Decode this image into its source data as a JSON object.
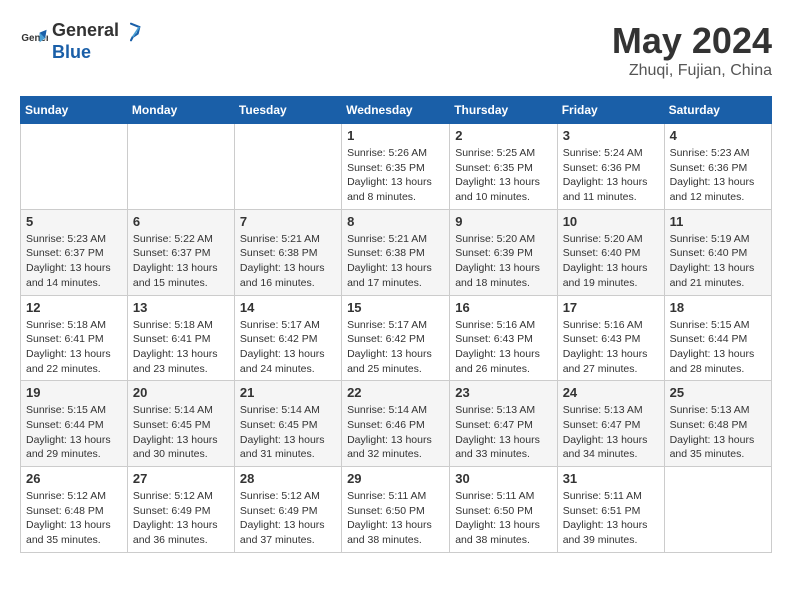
{
  "header": {
    "logo_general": "General",
    "logo_blue": "Blue",
    "month_year": "May 2024",
    "location": "Zhuqi, Fujian, China"
  },
  "weekdays": [
    "Sunday",
    "Monday",
    "Tuesday",
    "Wednesday",
    "Thursday",
    "Friday",
    "Saturday"
  ],
  "weeks": [
    [
      {
        "day": "",
        "info": ""
      },
      {
        "day": "",
        "info": ""
      },
      {
        "day": "",
        "info": ""
      },
      {
        "day": "1",
        "info": "Sunrise: 5:26 AM\nSunset: 6:35 PM\nDaylight: 13 hours\nand 8 minutes."
      },
      {
        "day": "2",
        "info": "Sunrise: 5:25 AM\nSunset: 6:35 PM\nDaylight: 13 hours\nand 10 minutes."
      },
      {
        "day": "3",
        "info": "Sunrise: 5:24 AM\nSunset: 6:36 PM\nDaylight: 13 hours\nand 11 minutes."
      },
      {
        "day": "4",
        "info": "Sunrise: 5:23 AM\nSunset: 6:36 PM\nDaylight: 13 hours\nand 12 minutes."
      }
    ],
    [
      {
        "day": "5",
        "info": "Sunrise: 5:23 AM\nSunset: 6:37 PM\nDaylight: 13 hours\nand 14 minutes."
      },
      {
        "day": "6",
        "info": "Sunrise: 5:22 AM\nSunset: 6:37 PM\nDaylight: 13 hours\nand 15 minutes."
      },
      {
        "day": "7",
        "info": "Sunrise: 5:21 AM\nSunset: 6:38 PM\nDaylight: 13 hours\nand 16 minutes."
      },
      {
        "day": "8",
        "info": "Sunrise: 5:21 AM\nSunset: 6:38 PM\nDaylight: 13 hours\nand 17 minutes."
      },
      {
        "day": "9",
        "info": "Sunrise: 5:20 AM\nSunset: 6:39 PM\nDaylight: 13 hours\nand 18 minutes."
      },
      {
        "day": "10",
        "info": "Sunrise: 5:20 AM\nSunset: 6:40 PM\nDaylight: 13 hours\nand 19 minutes."
      },
      {
        "day": "11",
        "info": "Sunrise: 5:19 AM\nSunset: 6:40 PM\nDaylight: 13 hours\nand 21 minutes."
      }
    ],
    [
      {
        "day": "12",
        "info": "Sunrise: 5:18 AM\nSunset: 6:41 PM\nDaylight: 13 hours\nand 22 minutes."
      },
      {
        "day": "13",
        "info": "Sunrise: 5:18 AM\nSunset: 6:41 PM\nDaylight: 13 hours\nand 23 minutes."
      },
      {
        "day": "14",
        "info": "Sunrise: 5:17 AM\nSunset: 6:42 PM\nDaylight: 13 hours\nand 24 minutes."
      },
      {
        "day": "15",
        "info": "Sunrise: 5:17 AM\nSunset: 6:42 PM\nDaylight: 13 hours\nand 25 minutes."
      },
      {
        "day": "16",
        "info": "Sunrise: 5:16 AM\nSunset: 6:43 PM\nDaylight: 13 hours\nand 26 minutes."
      },
      {
        "day": "17",
        "info": "Sunrise: 5:16 AM\nSunset: 6:43 PM\nDaylight: 13 hours\nand 27 minutes."
      },
      {
        "day": "18",
        "info": "Sunrise: 5:15 AM\nSunset: 6:44 PM\nDaylight: 13 hours\nand 28 minutes."
      }
    ],
    [
      {
        "day": "19",
        "info": "Sunrise: 5:15 AM\nSunset: 6:44 PM\nDaylight: 13 hours\nand 29 minutes."
      },
      {
        "day": "20",
        "info": "Sunrise: 5:14 AM\nSunset: 6:45 PM\nDaylight: 13 hours\nand 30 minutes."
      },
      {
        "day": "21",
        "info": "Sunrise: 5:14 AM\nSunset: 6:45 PM\nDaylight: 13 hours\nand 31 minutes."
      },
      {
        "day": "22",
        "info": "Sunrise: 5:14 AM\nSunset: 6:46 PM\nDaylight: 13 hours\nand 32 minutes."
      },
      {
        "day": "23",
        "info": "Sunrise: 5:13 AM\nSunset: 6:47 PM\nDaylight: 13 hours\nand 33 minutes."
      },
      {
        "day": "24",
        "info": "Sunrise: 5:13 AM\nSunset: 6:47 PM\nDaylight: 13 hours\nand 34 minutes."
      },
      {
        "day": "25",
        "info": "Sunrise: 5:13 AM\nSunset: 6:48 PM\nDaylight: 13 hours\nand 35 minutes."
      }
    ],
    [
      {
        "day": "26",
        "info": "Sunrise: 5:12 AM\nSunset: 6:48 PM\nDaylight: 13 hours\nand 35 minutes."
      },
      {
        "day": "27",
        "info": "Sunrise: 5:12 AM\nSunset: 6:49 PM\nDaylight: 13 hours\nand 36 minutes."
      },
      {
        "day": "28",
        "info": "Sunrise: 5:12 AM\nSunset: 6:49 PM\nDaylight: 13 hours\nand 37 minutes."
      },
      {
        "day": "29",
        "info": "Sunrise: 5:11 AM\nSunset: 6:50 PM\nDaylight: 13 hours\nand 38 minutes."
      },
      {
        "day": "30",
        "info": "Sunrise: 5:11 AM\nSunset: 6:50 PM\nDaylight: 13 hours\nand 38 minutes."
      },
      {
        "day": "31",
        "info": "Sunrise: 5:11 AM\nSunset: 6:51 PM\nDaylight: 13 hours\nand 39 minutes."
      },
      {
        "day": "",
        "info": ""
      }
    ]
  ]
}
